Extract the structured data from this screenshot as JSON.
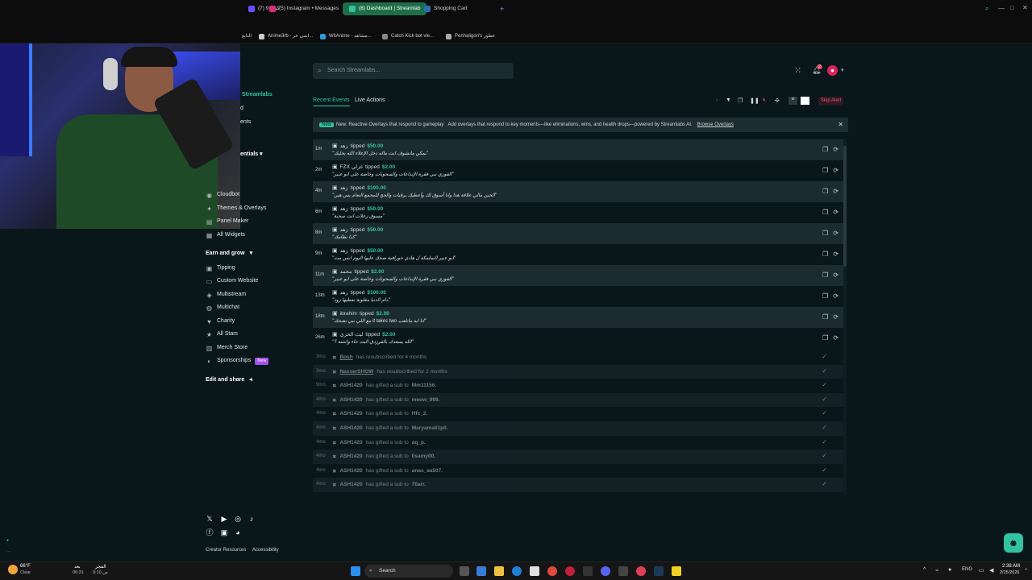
{
  "browser": {
    "tabs": [
      {
        "label": "كيف 9 (7)",
        "color": "#6a4cff"
      },
      {
        "label": "(5) Instagram • Messages",
        "color": "#d6317a"
      },
      {
        "label": "(8) Dashboard | Streamlab",
        "color": "#31c3a2",
        "active": true
      },
      {
        "label": "Shopping Cart",
        "color": "#2a6fb0"
      }
    ],
    "new_tab": "+",
    "bookmarks": [
      {
        "label": "التابع"
      },
      {
        "label": "Anime3rb - انمي عر..."
      },
      {
        "label": "WitAnime - مشاهد..."
      },
      {
        "label": "Catch Kick bot vie..."
      },
      {
        "label": "Penhaligon's عطور"
      }
    ]
  },
  "sidebar": {
    "partial_items": [
      "Streamlabs",
      "d",
      "ents",
      "entials"
    ],
    "items": [
      {
        "label": "Cloudbot",
        "icon": "cloud-icon"
      },
      {
        "label": "Themes & Overlays",
        "icon": "palette-icon"
      },
      {
        "label": "Panel Maker",
        "icon": "panel-icon"
      },
      {
        "label": "All Widgets",
        "icon": "widgets-icon"
      }
    ],
    "earn_group": "Earn and grow",
    "earn_items": [
      {
        "label": "Tipping",
        "icon": "tip-icon"
      },
      {
        "label": "Custom Website",
        "icon": "globe-icon"
      },
      {
        "label": "Multistream",
        "icon": "multistream-icon"
      },
      {
        "label": "Multichat",
        "icon": "chat-icon"
      },
      {
        "label": "Charity",
        "icon": "heart-icon"
      },
      {
        "label": "All Stars",
        "icon": "star-icon"
      },
      {
        "label": "Merch Store",
        "icon": "store-icon"
      },
      {
        "label": "Sponsorships",
        "icon": "sponsor-icon",
        "badge": "New"
      }
    ],
    "edit_group": "Edit and share",
    "footer_links": [
      "Creator Resources",
      "Accessibility"
    ]
  },
  "header": {
    "search_placeholder": "Search Streamlabs...",
    "notif_count": "2"
  },
  "tabs": {
    "recent": "Recent Events",
    "live": "Live Actions"
  },
  "skip_alert": "Skip Alert",
  "banner": {
    "badge": "New",
    "title": "New: Reactive Overlays that respond to gameplay",
    "text": "Add overlays that respond to key moments—like eliminations, wins, and health drops—powered by Streamlabs AI.",
    "link": "Browse Overlays"
  },
  "events": [
    {
      "time": "1m",
      "user": "زهد",
      "action": "tipped",
      "amount": "$50.00",
      "message": "\"يمكن ماتشوف انت ماله دخل الإعلاء الله بخليك\""
    },
    {
      "time": "2m",
      "user": "FZX غزلي",
      "action": "tipped",
      "amount": "$2.00",
      "message": "\"الفوزي نبي فقرة الإبداعات والسحوبات وخاصة على ابو عبير\""
    },
    {
      "time": "4m",
      "user": "زهد",
      "action": "tipped",
      "amount": "$100.00",
      "message": "\"الحين مالي علاقة هذا وانا أسوق لك وأعطيك برقيات والحج للمجمع النعام بس هين\""
    },
    {
      "time": "6m",
      "user": "زهد",
      "action": "tipped",
      "amount": "$50.00",
      "message": "\"مسوق زعلات انت سحبة\""
    },
    {
      "time": "8m",
      "user": "زهد",
      "action": "tipped",
      "amount": "$50.00",
      "message": "\"كذا نظامك\""
    },
    {
      "time": "9m",
      "user": "زهد",
      "action": "tipped",
      "amount": "$50.00",
      "message": "\"ابو عبير السلمكة ل هادي خورافية ضحك عليها اليوم انس مت\""
    },
    {
      "time": "11m",
      "user": "محمد",
      "action": "tipped",
      "amount": "$2.00",
      "message": "\"الفوزي نبي فقرة الإبداعات والسحوبات وخاصة على ابو عبير\""
    },
    {
      "time": "13m",
      "user": "زهد",
      "action": "tipped",
      "amount": "$100.00",
      "message": "\"دام الدنيا مقلوبة نعطيها زود\""
    },
    {
      "time": "18m",
      "user": "ibrahim",
      "action": "tipped",
      "amount": "$2.00",
      "message": "\"مع اللي نبي تضحك it takes two انا ابه مانلعب\""
    },
    {
      "time": "26m",
      "user": "ليث الحزي",
      "action": "tipped",
      "amount": "$2.00",
      "message": "\"الله يسعدك بالفرزدق البث جاء وانتنته ؟\""
    }
  ],
  "subs": [
    {
      "time": "3mo",
      "name": "Bosh",
      "text": "has resubscribed for 4 months",
      "underline": true
    },
    {
      "time": "3mo",
      "name": "NasserSHOW",
      "text": "has resubscribed for 2 months",
      "underline": true
    },
    {
      "time": "9mo",
      "name": "ASH1420",
      "text": "has gifted a sub to",
      "target": "Mm11156."
    },
    {
      "time": "4mo",
      "name": "ASH1420",
      "text": "has gifted a sub to",
      "target": "meow_999."
    },
    {
      "time": "4mo",
      "name": "ASH1420",
      "text": "has gifted a sub to",
      "target": "Hfc_2."
    },
    {
      "time": "4mo",
      "name": "ASH1420",
      "text": "has gifted a sub to",
      "target": "Maryamali1p0."
    },
    {
      "time": "4mo",
      "name": "ASH1420",
      "text": "has gifted a sub to",
      "target": "aq_p."
    },
    {
      "time": "4mo",
      "name": "ASH1420",
      "text": "has gifted a sub to",
      "target": "0samy00."
    },
    {
      "time": "4mo",
      "name": "ASH1420",
      "text": "has gifted a sub to",
      "target": "anas_aa507."
    },
    {
      "time": "4mo",
      "name": "ASH1420",
      "text": "has gifted a sub to",
      "target": "70arr."
    }
  ],
  "taskbar": {
    "weather_temp": "66°F",
    "weather_desc": "Clear",
    "prayer_name": "الفجر",
    "prayer_time": "9:10 ص",
    "prayer_next": "بعد",
    "prayer_count": "06:31",
    "search": "Search",
    "lang": "ENG",
    "time": "2:38 AM",
    "date": "2/25/2026"
  }
}
